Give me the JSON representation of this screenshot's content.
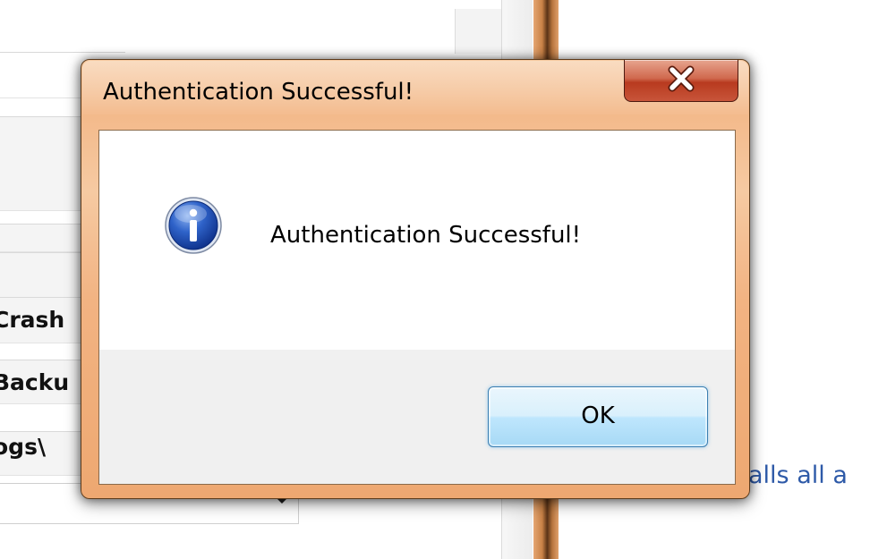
{
  "background": {
    "rows": [
      "Crash",
      "Backu",
      "ogs\\"
    ],
    "description_fragment": "alls all a"
  },
  "dialog": {
    "title": "Authentication Successful!",
    "message": "Authentication Successful!",
    "ok_label": "OK",
    "icon": "info-icon",
    "close_icon": "close-icon"
  },
  "colors": {
    "title_bar": "#f3b98a",
    "close_button": "#c8553a",
    "ok_button": "#bee6fd",
    "link_text": "#2e5aa8"
  }
}
